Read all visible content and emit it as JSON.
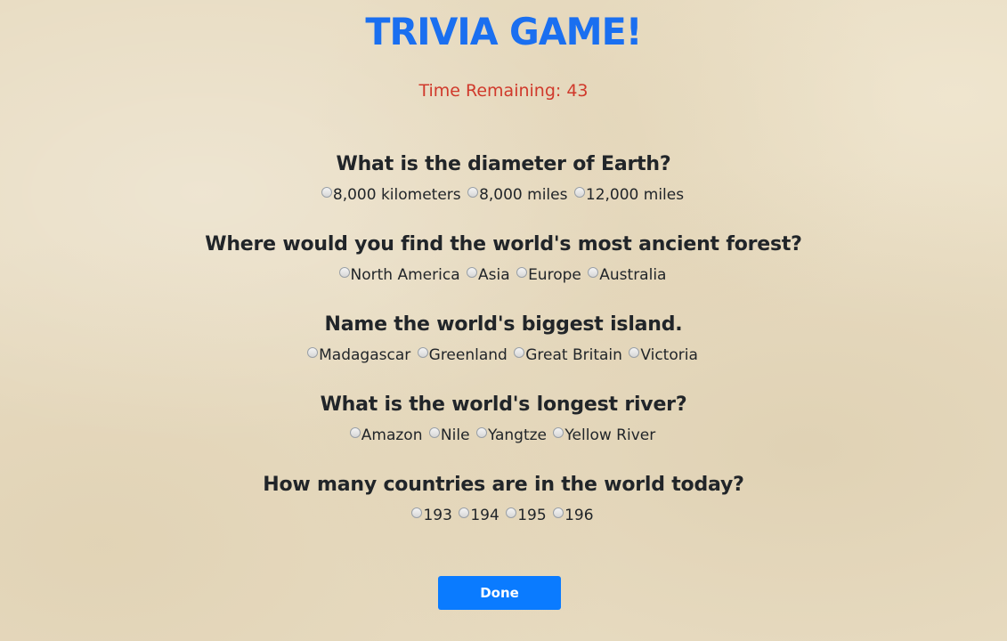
{
  "header": {
    "title": "Trivia Game!",
    "timer_text": "Time Remaining: 43"
  },
  "questions": [
    {
      "text": "What is the diameter of Earth?",
      "options": [
        "8,000 kilometers",
        "8,000 miles",
        "12,000 miles"
      ]
    },
    {
      "text": "Where would you find the world's most ancient forest?",
      "options": [
        "North America",
        "Asia",
        "Europe",
        "Australia"
      ]
    },
    {
      "text": "Name the world's biggest island.",
      "options": [
        "Madagascar",
        "Greenland",
        "Great Britain",
        "Victoria"
      ]
    },
    {
      "text": "What is the world's longest river?",
      "options": [
        "Amazon",
        "Nile",
        "Yangtze",
        "Yellow River"
      ]
    },
    {
      "text": "How many countries are in the world today?",
      "options": [
        "193",
        "194",
        "195",
        "196"
      ]
    }
  ],
  "actions": {
    "done_label": "Done"
  },
  "colors": {
    "title": "#1a6ff0",
    "timer": "#d0392b",
    "button": "#0a7bff",
    "background": "#e8dcc2"
  }
}
